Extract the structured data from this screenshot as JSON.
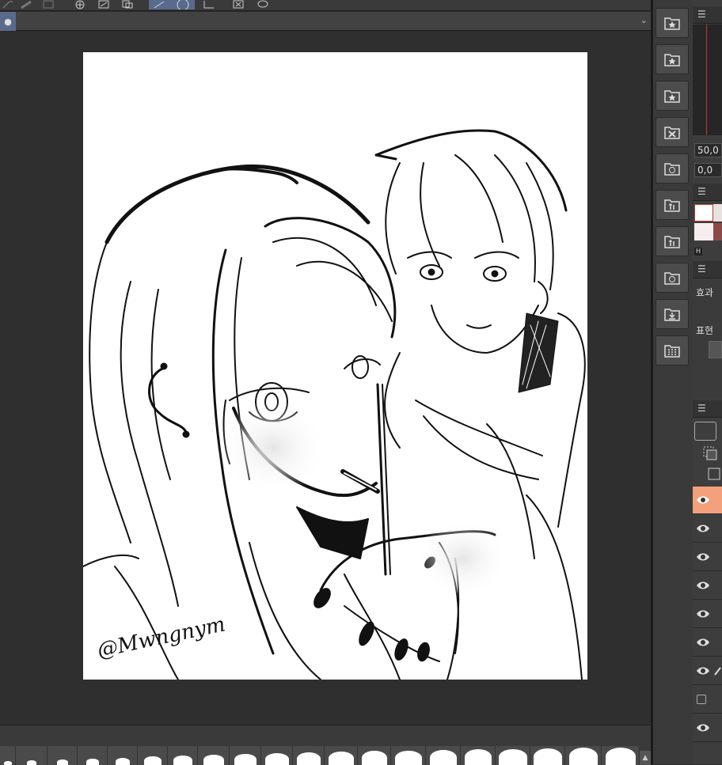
{
  "canvas": {
    "watermark": "@Mwngnym"
  },
  "tabs": {
    "active_icon": "●",
    "overflow_icon": "⌄"
  },
  "toolbar": {
    "icons": [
      "pen-icon",
      "ruler-icon",
      "grid-icon",
      "transform-icon",
      "export-icon",
      "lasso-icon",
      "ellipse-icon",
      "corner-icon",
      "selection-icon",
      "speech-icon"
    ]
  },
  "materials": {
    "buttons": [
      "star-folder-icon",
      "star-folder-icon",
      "star-folder-icon",
      "x-folder-icon",
      "face-folder-icon",
      "figure-folder-icon",
      "figure-folder-icon",
      "face-folder-icon",
      "download-folder-icon",
      "grid-folder-icon"
    ]
  },
  "right_panel": {
    "menu_icon": "☰",
    "navigator": {
      "zoom": "50,0",
      "rotation": "0,0"
    },
    "tool_property": {
      "effect_label": "효과",
      "expression_label": "표현"
    },
    "color_badge": "H",
    "accent_color": "#c0392b",
    "selected_layer_color": "#f3a07c"
  },
  "brushbar": {
    "scroll_up": "▲"
  }
}
